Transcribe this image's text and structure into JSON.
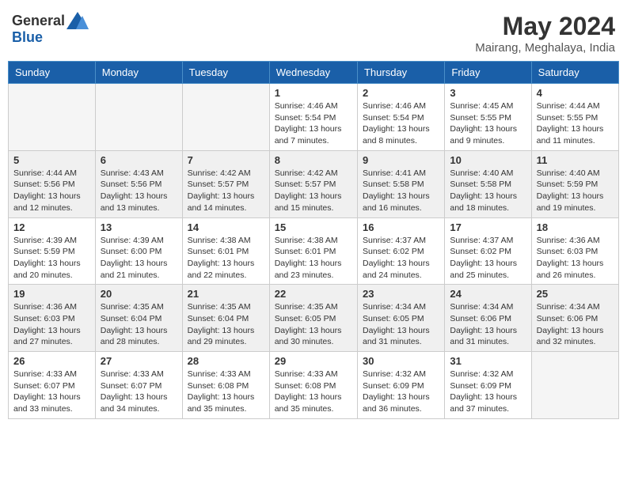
{
  "header": {
    "logo_general": "General",
    "logo_blue": "Blue",
    "month_year": "May 2024",
    "location": "Mairang, Meghalaya, India"
  },
  "days_of_week": [
    "Sunday",
    "Monday",
    "Tuesday",
    "Wednesday",
    "Thursday",
    "Friday",
    "Saturday"
  ],
  "weeks": [
    {
      "shaded": false,
      "days": [
        {
          "num": "",
          "info": ""
        },
        {
          "num": "",
          "info": ""
        },
        {
          "num": "",
          "info": ""
        },
        {
          "num": "1",
          "info": "Sunrise: 4:46 AM\nSunset: 5:54 PM\nDaylight: 13 hours and 7 minutes."
        },
        {
          "num": "2",
          "info": "Sunrise: 4:46 AM\nSunset: 5:54 PM\nDaylight: 13 hours and 8 minutes."
        },
        {
          "num": "3",
          "info": "Sunrise: 4:45 AM\nSunset: 5:55 PM\nDaylight: 13 hours and 9 minutes."
        },
        {
          "num": "4",
          "info": "Sunrise: 4:44 AM\nSunset: 5:55 PM\nDaylight: 13 hours and 11 minutes."
        }
      ]
    },
    {
      "shaded": true,
      "days": [
        {
          "num": "5",
          "info": "Sunrise: 4:44 AM\nSunset: 5:56 PM\nDaylight: 13 hours and 12 minutes."
        },
        {
          "num": "6",
          "info": "Sunrise: 4:43 AM\nSunset: 5:56 PM\nDaylight: 13 hours and 13 minutes."
        },
        {
          "num": "7",
          "info": "Sunrise: 4:42 AM\nSunset: 5:57 PM\nDaylight: 13 hours and 14 minutes."
        },
        {
          "num": "8",
          "info": "Sunrise: 4:42 AM\nSunset: 5:57 PM\nDaylight: 13 hours and 15 minutes."
        },
        {
          "num": "9",
          "info": "Sunrise: 4:41 AM\nSunset: 5:58 PM\nDaylight: 13 hours and 16 minutes."
        },
        {
          "num": "10",
          "info": "Sunrise: 4:40 AM\nSunset: 5:58 PM\nDaylight: 13 hours and 18 minutes."
        },
        {
          "num": "11",
          "info": "Sunrise: 4:40 AM\nSunset: 5:59 PM\nDaylight: 13 hours and 19 minutes."
        }
      ]
    },
    {
      "shaded": false,
      "days": [
        {
          "num": "12",
          "info": "Sunrise: 4:39 AM\nSunset: 5:59 PM\nDaylight: 13 hours and 20 minutes."
        },
        {
          "num": "13",
          "info": "Sunrise: 4:39 AM\nSunset: 6:00 PM\nDaylight: 13 hours and 21 minutes."
        },
        {
          "num": "14",
          "info": "Sunrise: 4:38 AM\nSunset: 6:01 PM\nDaylight: 13 hours and 22 minutes."
        },
        {
          "num": "15",
          "info": "Sunrise: 4:38 AM\nSunset: 6:01 PM\nDaylight: 13 hours and 23 minutes."
        },
        {
          "num": "16",
          "info": "Sunrise: 4:37 AM\nSunset: 6:02 PM\nDaylight: 13 hours and 24 minutes."
        },
        {
          "num": "17",
          "info": "Sunrise: 4:37 AM\nSunset: 6:02 PM\nDaylight: 13 hours and 25 minutes."
        },
        {
          "num": "18",
          "info": "Sunrise: 4:36 AM\nSunset: 6:03 PM\nDaylight: 13 hours and 26 minutes."
        }
      ]
    },
    {
      "shaded": true,
      "days": [
        {
          "num": "19",
          "info": "Sunrise: 4:36 AM\nSunset: 6:03 PM\nDaylight: 13 hours and 27 minutes."
        },
        {
          "num": "20",
          "info": "Sunrise: 4:35 AM\nSunset: 6:04 PM\nDaylight: 13 hours and 28 minutes."
        },
        {
          "num": "21",
          "info": "Sunrise: 4:35 AM\nSunset: 6:04 PM\nDaylight: 13 hours and 29 minutes."
        },
        {
          "num": "22",
          "info": "Sunrise: 4:35 AM\nSunset: 6:05 PM\nDaylight: 13 hours and 30 minutes."
        },
        {
          "num": "23",
          "info": "Sunrise: 4:34 AM\nSunset: 6:05 PM\nDaylight: 13 hours and 31 minutes."
        },
        {
          "num": "24",
          "info": "Sunrise: 4:34 AM\nSunset: 6:06 PM\nDaylight: 13 hours and 31 minutes."
        },
        {
          "num": "25",
          "info": "Sunrise: 4:34 AM\nSunset: 6:06 PM\nDaylight: 13 hours and 32 minutes."
        }
      ]
    },
    {
      "shaded": false,
      "days": [
        {
          "num": "26",
          "info": "Sunrise: 4:33 AM\nSunset: 6:07 PM\nDaylight: 13 hours and 33 minutes."
        },
        {
          "num": "27",
          "info": "Sunrise: 4:33 AM\nSunset: 6:07 PM\nDaylight: 13 hours and 34 minutes."
        },
        {
          "num": "28",
          "info": "Sunrise: 4:33 AM\nSunset: 6:08 PM\nDaylight: 13 hours and 35 minutes."
        },
        {
          "num": "29",
          "info": "Sunrise: 4:33 AM\nSunset: 6:08 PM\nDaylight: 13 hours and 35 minutes."
        },
        {
          "num": "30",
          "info": "Sunrise: 4:32 AM\nSunset: 6:09 PM\nDaylight: 13 hours and 36 minutes."
        },
        {
          "num": "31",
          "info": "Sunrise: 4:32 AM\nSunset: 6:09 PM\nDaylight: 13 hours and 37 minutes."
        },
        {
          "num": "",
          "info": ""
        }
      ]
    }
  ]
}
